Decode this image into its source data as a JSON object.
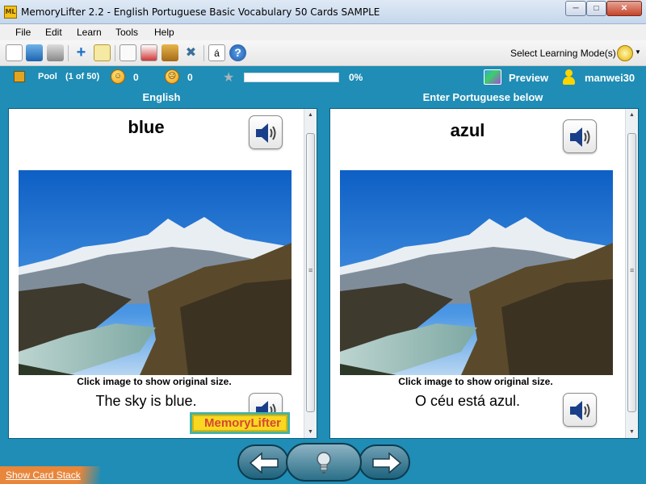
{
  "window": {
    "app_icon": "ML",
    "title": "MemoryLifter 2.2 - English Portuguese Basic Vocabulary 50 Cards SAMPLE"
  },
  "menu": [
    "File",
    "Edit",
    "Learn",
    "Tools",
    "Help"
  ],
  "toolbar": {
    "icons": [
      "new-file-icon",
      "open-folder-icon",
      "print-icon",
      "add-icon",
      "edit-card-icon",
      "presentation-icon",
      "card-deck-icon",
      "notes-icon",
      "tools-icon",
      "special-char-icon",
      "help-icon"
    ],
    "special_char": "á",
    "help": "?",
    "select_mode_label": "Select Learning Mode(s)"
  },
  "status": {
    "pool_label": "Pool",
    "pool_count": "(1 of 50)",
    "happy_count": "0",
    "sad_count": "0",
    "progress_percent": "0%",
    "progress_value": 0,
    "preview_label": "Preview",
    "username": "manwei30"
  },
  "question_panel": {
    "header": "English",
    "word": "blue",
    "caption": "Click image to show original size.",
    "sentence": "The sky is blue.",
    "logo_text": "MemoryLifter"
  },
  "answer_panel": {
    "header": "Enter Portuguese below",
    "word": "azul",
    "caption": "Click image to show original size.",
    "sentence": "O céu está azul."
  },
  "bottom": {
    "show_card_stack": "Show Card Stack",
    "hint_icon": "lightbulb-icon"
  },
  "colors": {
    "background": "#1f8db5",
    "accent_orange": "#e8863a"
  }
}
